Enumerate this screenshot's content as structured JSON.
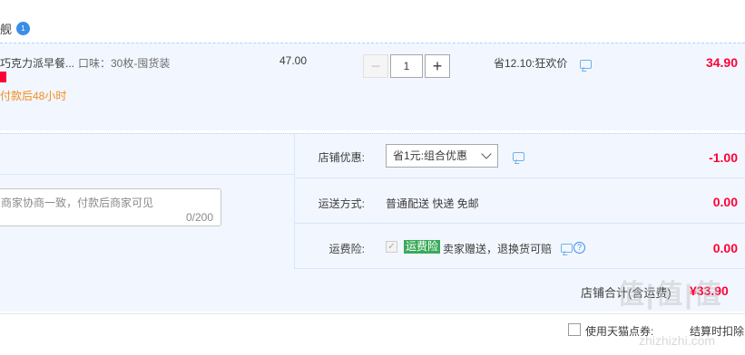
{
  "shop": {
    "name_tail": "舰",
    "wangwang_badge": "1"
  },
  "item": {
    "title": "巧克力派早餐...",
    "attr": "口味：30枚-囤货装",
    "tag": "",
    "ship_note": "付款后48小时",
    "unit_price": "47.00",
    "qty": "1",
    "qty_minus": "−",
    "qty_plus": "+",
    "promo": "省12.10:狂欢价",
    "subtotal": "34.90"
  },
  "order": {
    "coupon_label": "店铺优惠:",
    "coupon_value": "省1元:组合优惠",
    "coupon_amount": "-1.00",
    "ship_label": "运送方式:",
    "ship_value": "普通配送 快递 免邮",
    "ship_amount": "0.00",
    "ins_label": "运费险:",
    "ins_badge": "运费险",
    "ins_desc": "卖家赠送，退换货可赔",
    "ins_amount": "0.00",
    "message_placeholder": "商家协商一致，付款后商家可见",
    "message_count": "0/200",
    "shop_total_label": "店铺合计(含运费)",
    "shop_total": "¥33.90"
  },
  "bottom": {
    "coupon_label": "使用天猫点券:",
    "settle_label": "结算时扣除"
  },
  "watermark": {
    "text": "值|值|值",
    "url": "zhizhizhi.com"
  },
  "colors": {
    "price_red": "#ff0036",
    "info_bg": "#f2f7ff",
    "ship_orange": "#f48c1b",
    "ins_green": "#3aaa5a"
  }
}
